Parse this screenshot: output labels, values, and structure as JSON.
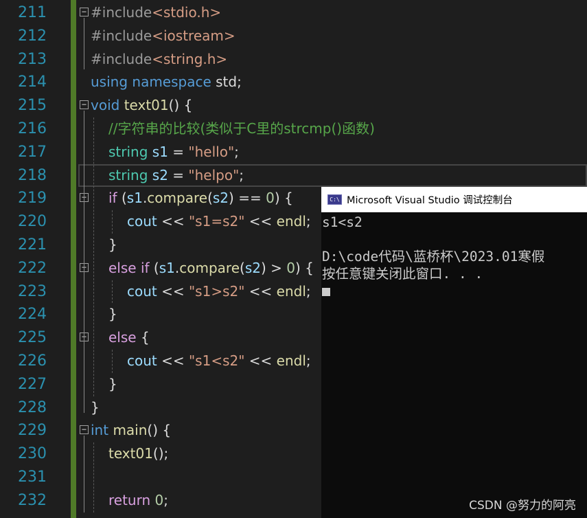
{
  "editor": {
    "line_numbers": [
      "211",
      "212",
      "213",
      "214",
      "215",
      "216",
      "217",
      "218",
      "219",
      "220",
      "221",
      "222",
      "223",
      "224",
      "225",
      "226",
      "227",
      "228",
      "229",
      "230",
      "231",
      "232"
    ],
    "lines": [
      [
        {
          "t": "#include",
          "c": "pp"
        },
        {
          "t": "<stdio.h>",
          "c": "hdr"
        }
      ],
      [
        {
          "t": "#include",
          "c": "pp"
        },
        {
          "t": "<iostream>",
          "c": "hdr"
        }
      ],
      [
        {
          "t": "#include",
          "c": "pp"
        },
        {
          "t": "<string.h>",
          "c": "hdr"
        }
      ],
      [
        {
          "t": "using",
          "c": "kw"
        },
        {
          "t": " ",
          "c": "plain"
        },
        {
          "t": "namespace",
          "c": "kw"
        },
        {
          "t": " std;",
          "c": "plain"
        }
      ],
      [
        {
          "t": "void",
          "c": "kw"
        },
        {
          "t": " ",
          "c": "plain"
        },
        {
          "t": "text01",
          "c": "fn"
        },
        {
          "t": "() {",
          "c": "plain"
        }
      ],
      [
        {
          "t": "//字符串的比较(类似于C里的strcmp()函数)",
          "c": "cmt"
        }
      ],
      [
        {
          "t": "string",
          "c": "type"
        },
        {
          "t": " ",
          "c": "plain"
        },
        {
          "t": "s1",
          "c": "var"
        },
        {
          "t": " = ",
          "c": "plain"
        },
        {
          "t": "\"hello\"",
          "c": "str"
        },
        {
          "t": ";",
          "c": "plain"
        }
      ],
      [
        {
          "t": "string",
          "c": "type"
        },
        {
          "t": " ",
          "c": "plain"
        },
        {
          "t": "s2",
          "c": "var"
        },
        {
          "t": " = ",
          "c": "plain"
        },
        {
          "t": "\"helpo\"",
          "c": "str"
        },
        {
          "t": ";",
          "c": "plain"
        }
      ],
      [
        {
          "t": "if",
          "c": "ctl"
        },
        {
          "t": " (",
          "c": "plain"
        },
        {
          "t": "s1",
          "c": "var"
        },
        {
          "t": ".",
          "c": "plain"
        },
        {
          "t": "compare",
          "c": "fn"
        },
        {
          "t": "(",
          "c": "plain"
        },
        {
          "t": "s2",
          "c": "var"
        },
        {
          "t": ") == ",
          "c": "plain"
        },
        {
          "t": "0",
          "c": "num"
        },
        {
          "t": ") {",
          "c": "plain"
        }
      ],
      [
        {
          "t": "cout",
          "c": "var"
        },
        {
          "t": " << ",
          "c": "plain"
        },
        {
          "t": "\"s1=s2\"",
          "c": "str"
        },
        {
          "t": " << ",
          "c": "plain"
        },
        {
          "t": "endl",
          "c": "fn"
        },
        {
          "t": ";",
          "c": "plain"
        }
      ],
      [
        {
          "t": "}",
          "c": "plain"
        }
      ],
      [
        {
          "t": "else",
          "c": "ctl"
        },
        {
          "t": " ",
          "c": "plain"
        },
        {
          "t": "if",
          "c": "ctl"
        },
        {
          "t": " (",
          "c": "plain"
        },
        {
          "t": "s1",
          "c": "var"
        },
        {
          "t": ".",
          "c": "plain"
        },
        {
          "t": "compare",
          "c": "fn"
        },
        {
          "t": "(",
          "c": "plain"
        },
        {
          "t": "s2",
          "c": "var"
        },
        {
          "t": ") > ",
          "c": "plain"
        },
        {
          "t": "0",
          "c": "num"
        },
        {
          "t": ") {",
          "c": "plain"
        }
      ],
      [
        {
          "t": "cout",
          "c": "var"
        },
        {
          "t": " << ",
          "c": "plain"
        },
        {
          "t": "\"s1>s2\"",
          "c": "str"
        },
        {
          "t": " << ",
          "c": "plain"
        },
        {
          "t": "endl",
          "c": "fn"
        },
        {
          "t": ";",
          "c": "plain"
        }
      ],
      [
        {
          "t": "}",
          "c": "plain"
        }
      ],
      [
        {
          "t": "else",
          "c": "ctl"
        },
        {
          "t": " {",
          "c": "plain"
        }
      ],
      [
        {
          "t": "cout",
          "c": "var"
        },
        {
          "t": " << ",
          "c": "plain"
        },
        {
          "t": "\"s1<s2\"",
          "c": "str"
        },
        {
          "t": " << ",
          "c": "plain"
        },
        {
          "t": "endl",
          "c": "fn"
        },
        {
          "t": ";",
          "c": "plain"
        }
      ],
      [
        {
          "t": "}",
          "c": "plain"
        }
      ],
      [
        {
          "t": "}",
          "c": "plain"
        }
      ],
      [
        {
          "t": "int",
          "c": "kw"
        },
        {
          "t": " ",
          "c": "plain"
        },
        {
          "t": "main",
          "c": "fn"
        },
        {
          "t": "() {",
          "c": "plain"
        }
      ],
      [
        {
          "t": "text01",
          "c": "fn"
        },
        {
          "t": "();",
          "c": "plain"
        }
      ],
      [],
      [
        {
          "t": "return",
          "c": "ctl"
        },
        {
          "t": " ",
          "c": "plain"
        },
        {
          "t": "0",
          "c": "num"
        },
        {
          "t": ";",
          "c": "plain"
        }
      ]
    ]
  },
  "console": {
    "title": "Microsoft Visual Studio 调试控制台",
    "icon": "console-app-icon",
    "icon_text": "C:\\",
    "output": [
      "s1<s2",
      "",
      "D:\\code代码\\蓝桥杯\\2023.01寒假",
      "按任意键关闭此窗口. . ."
    ]
  },
  "watermark": "CSDN @努力的阿亮",
  "colors": {
    "background": "#1e1e1e",
    "line_number": "#2b91af",
    "change_bar": "#4f7a28",
    "console_background": "#0c0c0c"
  }
}
